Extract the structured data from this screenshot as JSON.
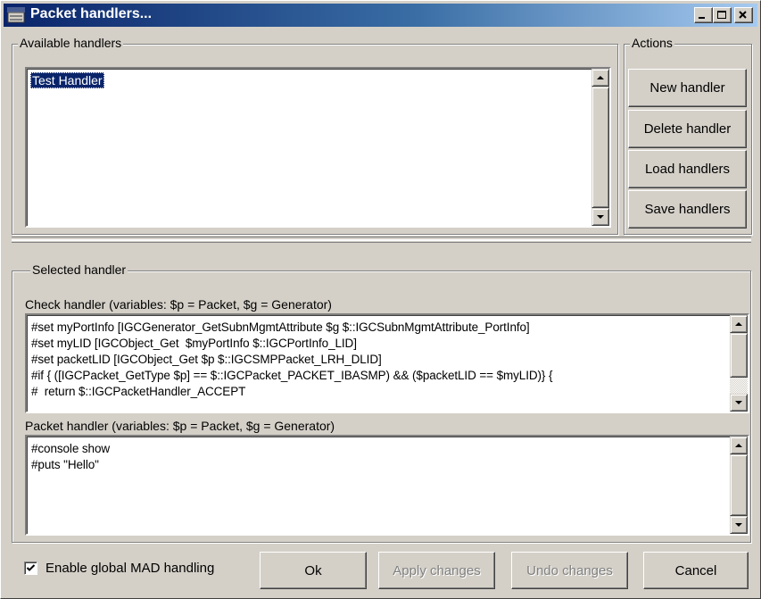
{
  "window": {
    "title": "Packet handlers...",
    "app_icon_text": "MAD"
  },
  "available_handlers": {
    "label": "Available handlers",
    "items": [
      "Test Handler"
    ],
    "selected_index": 0
  },
  "actions": {
    "label": "Actions",
    "new_handler": "New handler",
    "delete_handler": "Delete handler",
    "load_handlers": "Load handlers",
    "save_handlers": "Save handlers"
  },
  "selected_handler": {
    "label": "Selected handler",
    "check_handler_label": "Check handler (variables: $p = Packet, $g = Generator)",
    "check_handler_lines": [
      "#set myPortInfo [IGCGenerator_GetSubnMgmtAttribute $g $::IGCSubnMgmtAttribute_PortInfo]",
      "#set myLID [IGCObject_Get  $myPortInfo $::IGCPortInfo_LID]",
      "#set packetLID [IGCObject_Get $p $::IGCSMPPacket_LRH_DLID]",
      "#if { ([IGCPacket_GetType $p] == $::IGCPacket_PACKET_IBASMP) && ($packetLID == $myLID)} {",
      "#  return $::IGCPacketHandler_ACCEPT"
    ],
    "packet_handler_label": "Packet handler (variables: $p = Packet, $g = Generator)",
    "packet_handler_lines": [
      "#console show",
      "#puts \"Hello\""
    ]
  },
  "footer": {
    "enable_global_mad_label": "Enable global MAD handling",
    "enable_global_mad_checked": true,
    "ok": "Ok",
    "apply_changes": "Apply changes",
    "undo_changes": "Undo changes",
    "cancel": "Cancel"
  }
}
